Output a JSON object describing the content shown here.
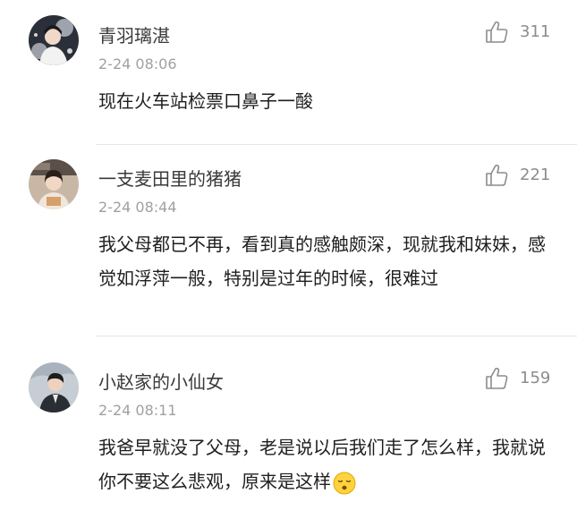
{
  "comments": [
    {
      "username": "青羽璃湛",
      "time": "2-24 08:06",
      "likes": "311",
      "text": "现在火车站检票口鼻子一酸",
      "avatar_icon": "user-avatar"
    },
    {
      "username": "一支麦田里的猪猪",
      "time": "2-24 08:44",
      "likes": "221",
      "text": "我父母都已不再，看到真的感触颇深，现就我和妹妹，感觉如浮萍一般，特别是过年的时候，很难过",
      "avatar_icon": "user-avatar"
    },
    {
      "username": "小赵家的小仙女",
      "time": "2-24 08:11",
      "likes": "159",
      "text": "我爸早就没了父母，老是说以后我们走了怎么样，我就说你不要这么悲观，原来是这样",
      "emoji": "sad-face-emoji",
      "avatar_icon": "user-avatar"
    }
  ],
  "colors": {
    "username": "#3a3a3a",
    "time": "#a0a0a0",
    "like": "#8c8c8c",
    "text": "#1e1e1e",
    "divider": "#e6e6e6"
  }
}
